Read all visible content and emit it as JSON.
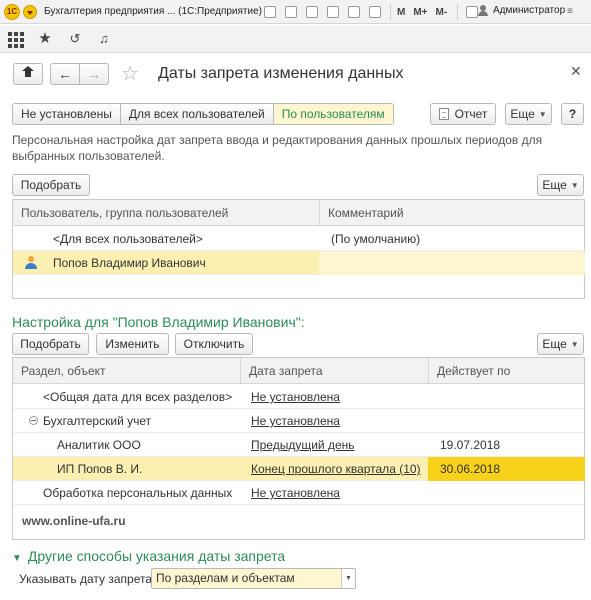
{
  "titlebar": {
    "logo": "1С",
    "title": "Бухгалтерия предприятия  ... (1С:Предприятие)",
    "tools": [
      "M",
      "M+",
      "M-"
    ],
    "user": "Администратор"
  },
  "form": {
    "title": "Даты запрета изменения данных"
  },
  "tabs": [
    {
      "label": "Не установлены"
    },
    {
      "label": "Для всех пользователей"
    },
    {
      "label": "По пользователям",
      "active": true
    }
  ],
  "buttons": {
    "report": "Отчет",
    "more": "Еще",
    "help": "?",
    "pick": "Подобрать",
    "edit": "Изменить",
    "disable": "Отключить"
  },
  "description": "Персональная настройка дат запрета ввода и редактирования данных прошлых периодов для выбранных пользователей.",
  "users_table": {
    "columns": [
      "Пользователь, группа пользователей",
      "Комментарий"
    ],
    "rows": [
      {
        "user": "<Для всех пользователей>",
        "comment": "(По умолчанию)"
      },
      {
        "user": "Попов Владимир Иванович",
        "comment": ""
      }
    ]
  },
  "settings_title": "Настройка для \"Попов Владимир Иванович\":",
  "sections_table": {
    "columns": [
      "Раздел, объект",
      "Дата запрета",
      "Действует по"
    ],
    "rows": [
      {
        "section": "<Общая дата для всех разделов>",
        "date": "Не установлена",
        "valid": ""
      },
      {
        "section": "Бухгалтерский учет",
        "date": "Не установлена",
        "valid": ""
      },
      {
        "section": "Аналитик ООО",
        "date": "Предыдущий день",
        "valid": "19.07.2018"
      },
      {
        "section": "ИП Попов В. И.",
        "date": "Конец прошлого квартала (10)",
        "valid": "30.06.2018"
      },
      {
        "section": "Обработка персональных данных",
        "date": "Не установлена",
        "valid": ""
      }
    ]
  },
  "watermark": "www.online-ufa.ru",
  "other": {
    "title": "Другие способы указания даты запрета",
    "date_label": "Указывать дату запрета:",
    "date_value": "По разделам и объектам"
  }
}
